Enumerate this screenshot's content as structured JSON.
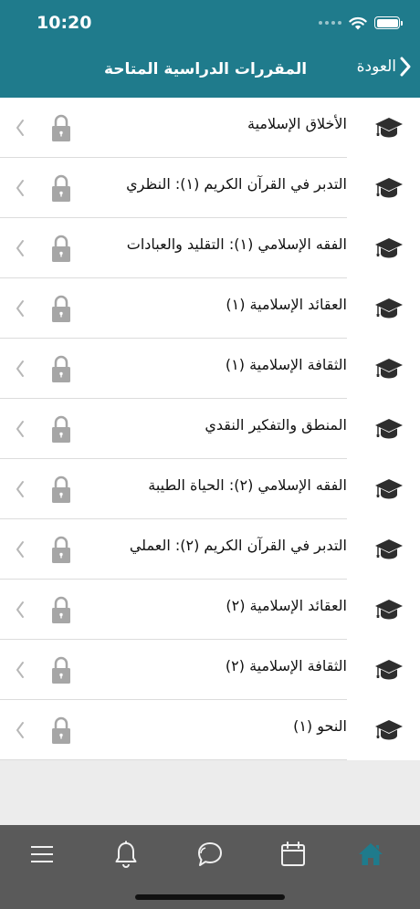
{
  "status": {
    "time": "10:20"
  },
  "nav": {
    "title": "المقررات الدراسية المتاحة",
    "back_label": "العودة"
  },
  "courses": [
    {
      "title": "الأخلاق الإسلامية"
    },
    {
      "title": "التدبر في القرآن الكريم (١): النظري"
    },
    {
      "title": "الفقه الإسلامي (١): التقليد والعبادات"
    },
    {
      "title": "العقائد الإسلامية (١)"
    },
    {
      "title": "الثقافة الإسلامية (١)"
    },
    {
      "title": "المنطق والتفكير النقدي"
    },
    {
      "title": "الفقه الإسلامي (٢): الحياة الطيبة"
    },
    {
      "title": "التدبر في القرآن الكريم (٢): العملي"
    },
    {
      "title": "العقائد الإسلامية (٢)"
    },
    {
      "title": "الثقافة الإسلامية (٢)"
    },
    {
      "title": "النحو (١)"
    }
  ],
  "row_icons": {
    "leading": "graduation-cap-icon",
    "lock": "lock-icon",
    "chevron": "chevron-left-icon"
  },
  "tabbar": {
    "tabs": [
      {
        "icon": "home-icon",
        "selected": true
      },
      {
        "icon": "calendar-icon",
        "selected": false
      },
      {
        "icon": "chat-icon",
        "selected": false
      },
      {
        "icon": "bell-icon",
        "selected": false
      },
      {
        "icon": "menu-icon",
        "selected": false
      }
    ]
  },
  "colors": {
    "header": "#1f7b8c",
    "tabbar": "#5a5a5a",
    "tab_selected": "#1f7b8c",
    "tab_icon": "#f0f0f0",
    "lock": "#a6a6a6",
    "chevron": "#b7b7b7",
    "cap": "#2e2e2e",
    "background": "#ececec"
  }
}
